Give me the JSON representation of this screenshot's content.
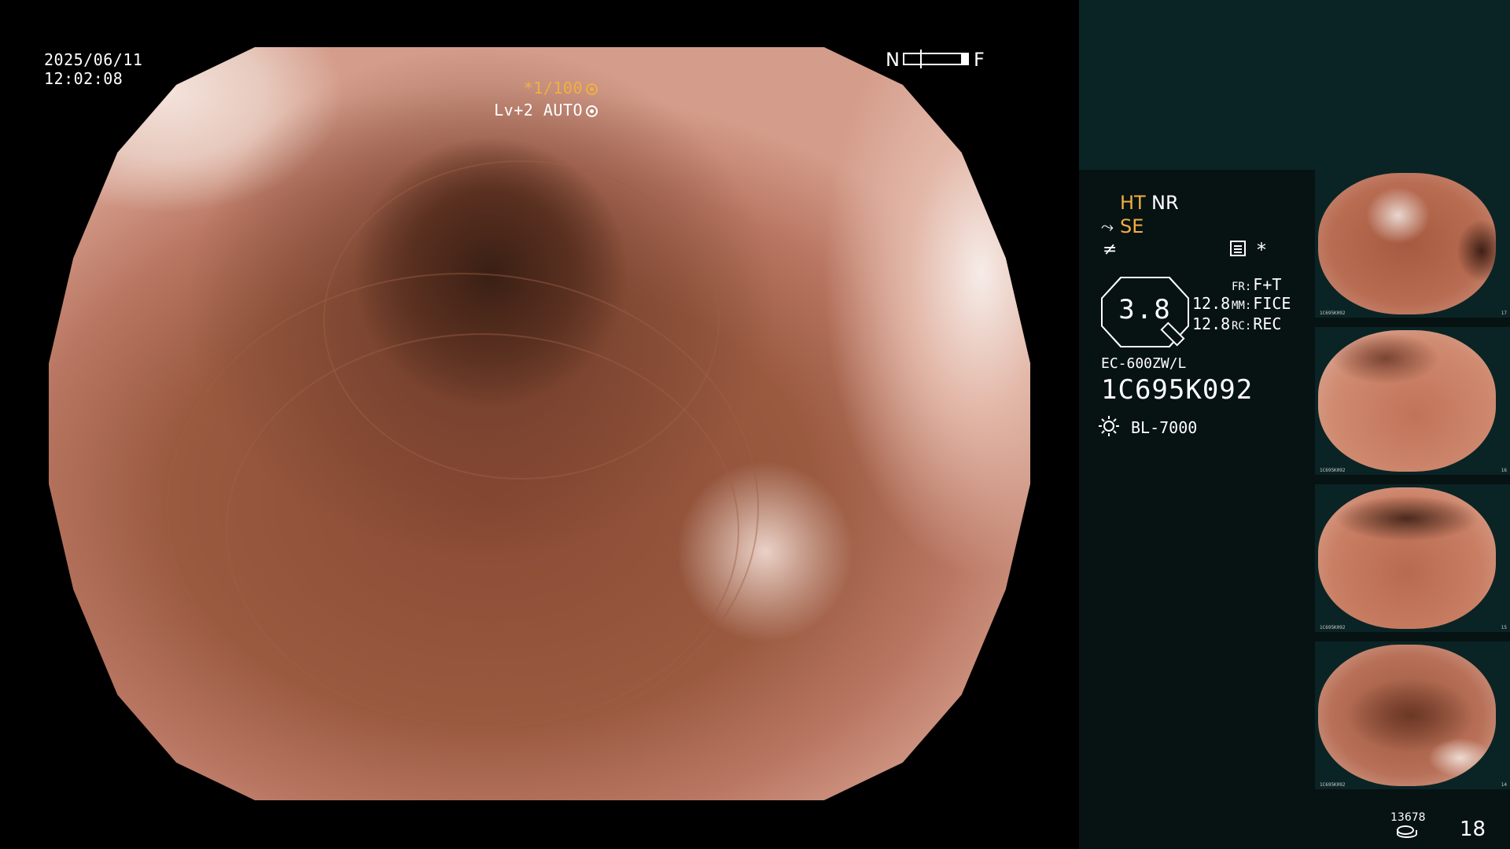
{
  "osd": {
    "date": "2025/06/11",
    "time": "12:02:08",
    "nf_near": "N",
    "nf_far": "F",
    "shutter": "*1/100",
    "iris": "Lv+2 AUTO"
  },
  "panel": {
    "ht": "HT",
    "nr": "NR",
    "se": "SE",
    "asterisk": "*",
    "zoom": "3.8",
    "value_a": "12.8",
    "value_b": "12.8",
    "fr_key": "FR:",
    "fr_val": "F+T",
    "mm_key": "MM:",
    "mm_val": "FICE",
    "rc_key": "RC:",
    "rc_val": "REC",
    "scope_model": "EC-600ZW/L",
    "scope_serial": "1C695K092",
    "light_source": "BL-7000",
    "storage_count": "13678",
    "image_count": "18"
  },
  "thumbnails": [
    {
      "id": "1C695K092",
      "num": "17"
    },
    {
      "id": "1C695K092",
      "num": "16"
    },
    {
      "id": "1C695K092",
      "num": "15"
    },
    {
      "id": "1C695K092",
      "num": "14"
    }
  ],
  "colors": {
    "accent_orange": "#f0b040",
    "panel_bg": "#071213",
    "panel_top_bg": "#0a2425"
  }
}
